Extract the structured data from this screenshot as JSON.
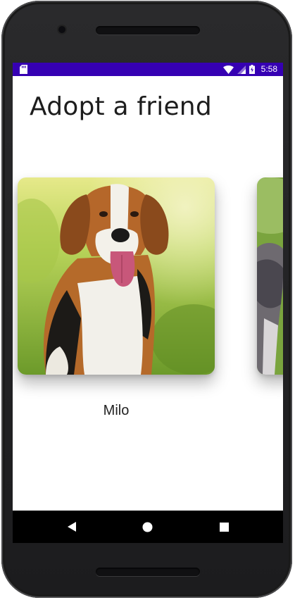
{
  "status_bar": {
    "time": "5:58",
    "background": "#3600b3",
    "icons": [
      "sd-card-icon",
      "wifi-icon",
      "signal-icon",
      "battery-icon"
    ]
  },
  "screen": {
    "title": "Adopt a friend"
  },
  "carousel": {
    "items": [
      {
        "name": "Milo",
        "image": "beagle-photo"
      },
      {
        "name": "",
        "image": "husky-photo"
      }
    ]
  },
  "nav_bar": {
    "buttons": [
      "back-icon",
      "home-icon",
      "recents-icon"
    ]
  }
}
